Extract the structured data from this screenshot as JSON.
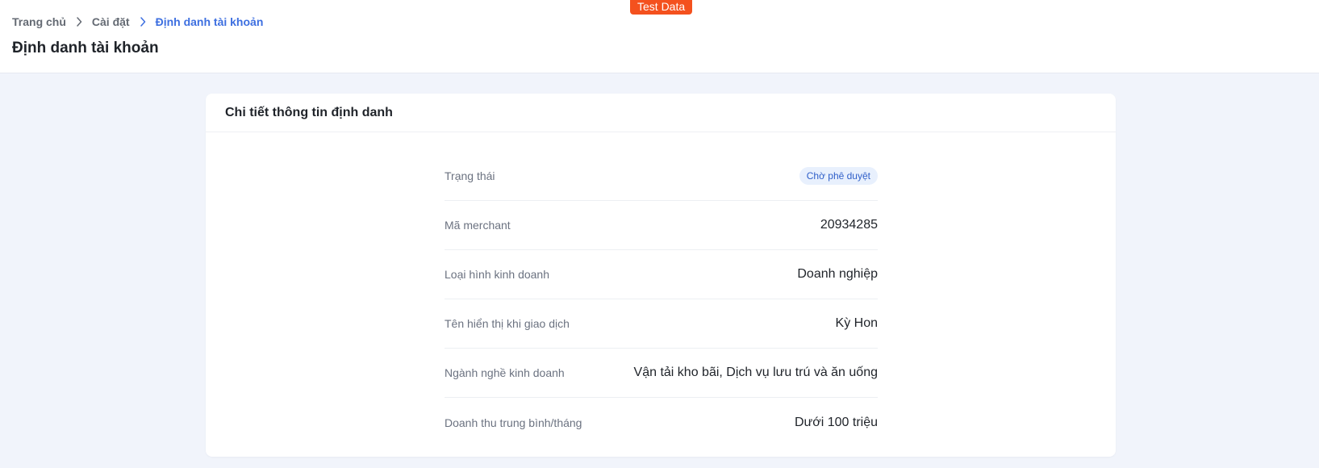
{
  "badge": {
    "label": "Test Data",
    "color": "#f4511e"
  },
  "breadcrumb": {
    "items": [
      {
        "label": "Trang chủ"
      },
      {
        "label": "Cài đặt"
      },
      {
        "label": "Định danh tài khoản"
      }
    ],
    "separator_icon": "chevron-right-icon"
  },
  "page": {
    "title": "Định danh tài khoản"
  },
  "card": {
    "title": "Chi tiết thông tin định danh",
    "status": {
      "label": "Trạng thái",
      "value": "Chờ phê duyệt"
    },
    "rows": [
      {
        "label": "Mã merchant",
        "value": "20934285"
      },
      {
        "label": "Loại hình kinh doanh",
        "value": "Doanh nghiệp"
      },
      {
        "label": "Tên hiển thị khi giao dịch",
        "value": "Kỳ Hon"
      },
      {
        "label": "Ngành nghề kinh doanh",
        "value": "Vận tải kho bãi, Dịch vụ lưu trú và ăn uống"
      },
      {
        "label": "Doanh thu trung bình/tháng",
        "value": "Dưới 100 triệu"
      }
    ]
  },
  "colors": {
    "accent": "#3d6fe0",
    "background": "#f1f4fb",
    "status_badge_bg": "#e8f0fd"
  }
}
